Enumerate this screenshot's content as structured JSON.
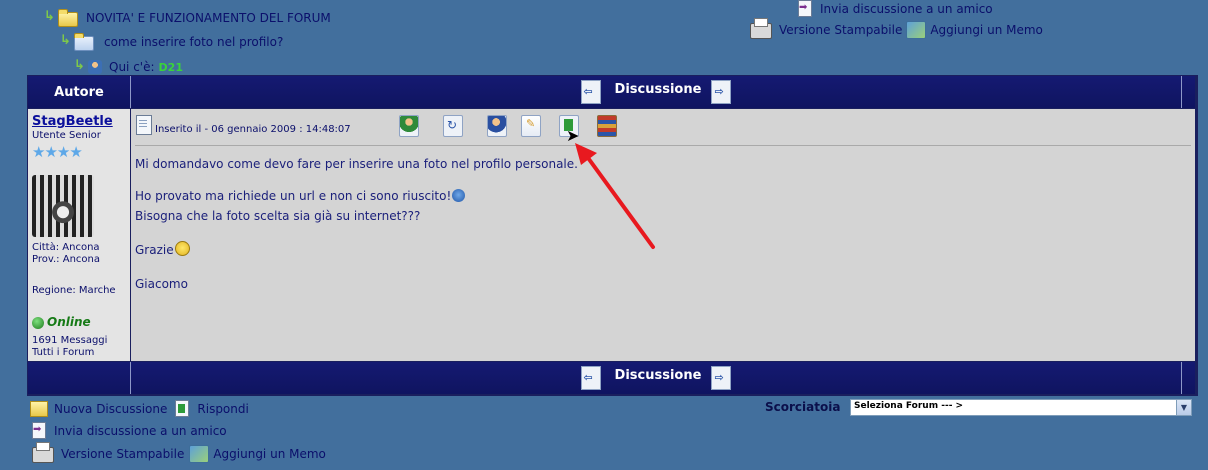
{
  "breadcrumb": {
    "forum": "NOVITA' E FUNZIONAMENTO DEL FORUM",
    "topic": "come inserire foto nel profilo?",
    "here_label": "Qui c'è:",
    "here_value": "D21"
  },
  "top_links": {
    "send_friend": "Invia discussione a un amico",
    "printable": "Versione Stampabile",
    "add_memo": "Aggiungi un Memo"
  },
  "table": {
    "author_header": "Autore",
    "discussion_header": "Discussione"
  },
  "author": {
    "name": "StagBeetle",
    "rank": "Utente Senior",
    "stars": "★★★★",
    "city": "Città: Ancona",
    "province": "Prov.: Ancona",
    "region": "Regione: Marche",
    "status": "Online",
    "messages": "1691 Messaggi",
    "all_forums": "Tutti i Forum"
  },
  "post": {
    "posted": "Inserito il - 06 gennaio 2009 : 14:48:07",
    "line1": "Mi domandavo come devo fare per inserire una foto nel profilo personale.",
    "line2": "Ho provato ma richiede un url e non ci sono riuscito!",
    "line3": "Bisogna che la foto scelta sia già su internet???",
    "line4": "Grazie",
    "line5": "Giacomo"
  },
  "bottom_links": {
    "new_discussion": "Nuova Discussione",
    "reply": "Rispondi",
    "send_friend": "Invia discussione a un amico",
    "printable": "Versione Stampabile",
    "add_memo": "Aggiungi un Memo"
  },
  "shortcut": {
    "label": "Scorciatoia",
    "selected": "Seleziona Forum --- >"
  },
  "colors": {
    "background": "#426f9d",
    "header": "#0f1460",
    "post_bg": "#d4d4d4",
    "annotation": "#e8191f"
  },
  "icons": [
    "folder-icon",
    "tree-branch-icon",
    "topic-icon",
    "user-icon",
    "send-doc-icon",
    "printer-icon",
    "memo-icon",
    "profile-icon",
    "reply-icon",
    "edit-icon",
    "quote-icon",
    "bookmark-icon",
    "books-icon",
    "prev-arrow-icon",
    "next-arrow-icon",
    "online-icon",
    "new-topic-icon"
  ]
}
